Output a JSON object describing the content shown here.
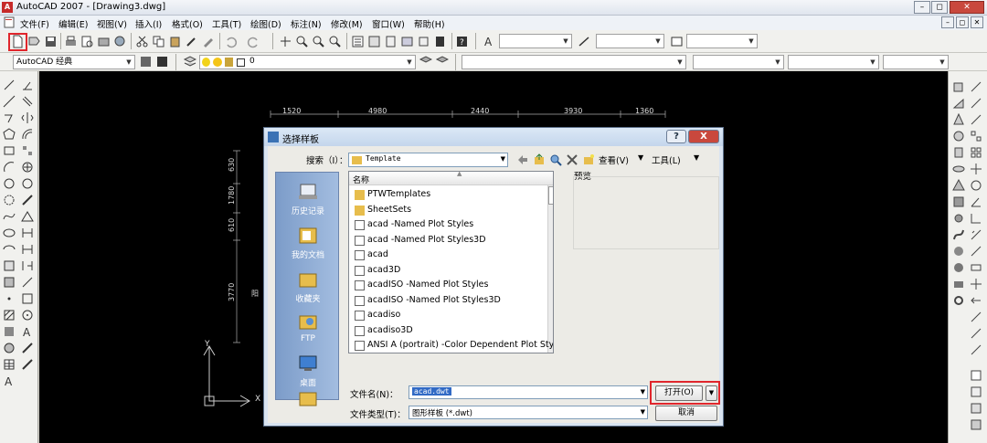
{
  "window": {
    "title": "AutoCAD 2007 - [Drawing3.dwg]"
  },
  "menu": [
    "文件(F)",
    "编辑(E)",
    "视图(V)",
    "插入(I)",
    "格式(O)",
    "工具(T)",
    "绘图(D)",
    "标注(N)",
    "修改(M)",
    "窗口(W)",
    "帮助(H)"
  ],
  "toolbar": {
    "workspace": "AutoCAD 经典",
    "layer_value": "0"
  },
  "drawing": {
    "dims_top": [
      "1520",
      "4980",
      "2440",
      "3930",
      "1360"
    ],
    "dims_left": [
      "630",
      "1780",
      "610",
      "3770"
    ],
    "axis_y": "Y",
    "axis_x": "X",
    "side_mark": "阳"
  },
  "dialog": {
    "title": "选择样板",
    "help": "?",
    "close": "X",
    "search_label": "搜索（I）：",
    "search_folder": "Template",
    "view_label": "查看(V)",
    "tools_label": "工具(L)",
    "preview_label": "预览",
    "places": [
      "历史记录",
      "我的文档",
      "收藏夹",
      "FTP",
      "桌面"
    ],
    "column_name": "名称",
    "files": [
      {
        "name": "PTWTemplates",
        "type": "folder"
      },
      {
        "name": "SheetSets",
        "type": "folder"
      },
      {
        "name": "acad -Named Plot Styles",
        "type": "dwt"
      },
      {
        "name": "acad -Named Plot Styles3D",
        "type": "dwt"
      },
      {
        "name": "acad",
        "type": "dwt"
      },
      {
        "name": "acad3D",
        "type": "dwt"
      },
      {
        "name": "acadISO -Named Plot Styles",
        "type": "dwt"
      },
      {
        "name": "acadISO -Named Plot Styles3D",
        "type": "dwt"
      },
      {
        "name": "acadiso",
        "type": "dwt"
      },
      {
        "name": "acadiso3D",
        "type": "dwt"
      },
      {
        "name": "ANSI A (portrait) -Color Dependent Plot Style",
        "type": "dwt"
      }
    ],
    "filename_label": "文件名(N)：",
    "filename_value": "acad.dwt",
    "filetype_label": "文件类型(T)：",
    "filetype_value": "图形样板 (*.dwt)",
    "open_button": "打开(O)",
    "cancel_button": "取消"
  },
  "colors": {
    "highlight": "#e0262c",
    "canvas": "#000000",
    "selection": "#316ac5"
  }
}
